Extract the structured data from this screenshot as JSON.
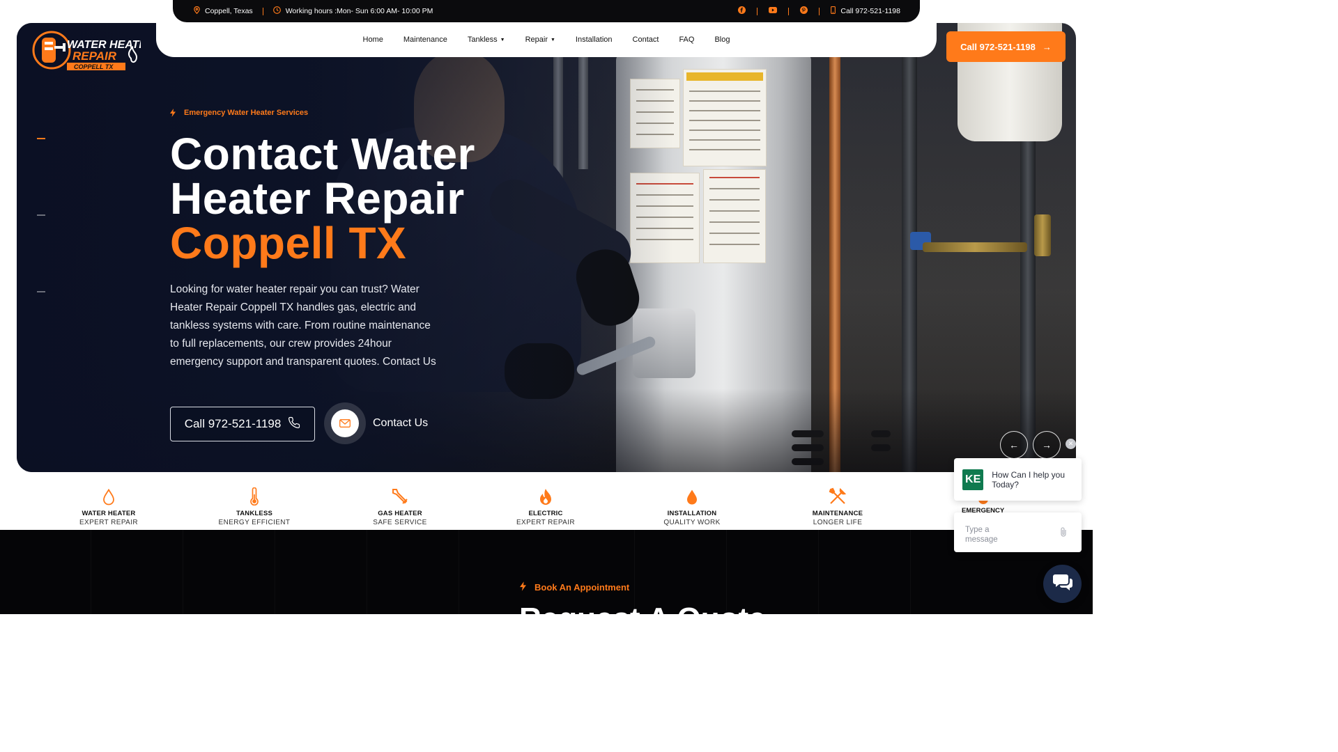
{
  "topbar": {
    "location": "Coppell, Texas",
    "hours": "Working hours :Mon- Sun 6:00 AM- 10:00 PM",
    "phone": "Call 972-521-1198",
    "social_icons": [
      "facebook-icon",
      "youtube-icon",
      "pinterest-icon"
    ]
  },
  "logo": {
    "line1": "WATER HEATER",
    "line2": "REPAIR",
    "line3": "COPPELL TX"
  },
  "nav": {
    "items": [
      {
        "label": "Home",
        "dropdown": false
      },
      {
        "label": "Maintenance",
        "dropdown": false
      },
      {
        "label": "Tankless",
        "dropdown": true
      },
      {
        "label": "Repair",
        "dropdown": true
      },
      {
        "label": "Installation",
        "dropdown": false
      },
      {
        "label": "Contact",
        "dropdown": false
      },
      {
        "label": "FAQ",
        "dropdown": false
      },
      {
        "label": "Blog",
        "dropdown": false
      }
    ],
    "cta_label": "Call 972-521-1198"
  },
  "hero": {
    "eyebrow": "Emergency Water Heater Services",
    "title_line1": "Contact Water",
    "title_line2": "Heater Repair",
    "title_accent": "Coppell TX",
    "description": "Looking for water heater repair you can trust? Water Heater Repair Coppell TX handles gas, electric and tankless systems with care. From routine maintenance to full replacements, our crew provides 24hour emergency support and transparent quotes. Contact Us",
    "call_button": "Call 972-521-1198",
    "contact_link": "Contact Us"
  },
  "services": [
    {
      "title": "WATER HEATER",
      "subtitle": "EXPERT REPAIR",
      "icon": "water-drop-icon"
    },
    {
      "title": "TANKLESS",
      "subtitle": "ENERGY EFFICIENT",
      "icon": "thermometer-icon"
    },
    {
      "title": "GAS HEATER",
      "subtitle": "SAFE SERVICE",
      "icon": "wrench-icon"
    },
    {
      "title": "ELECTRIC",
      "subtitle": "EXPERT REPAIR",
      "icon": "flame-icon"
    },
    {
      "title": "INSTALLATION",
      "subtitle": "QUALITY WORK",
      "icon": "filled-drop-icon"
    },
    {
      "title": "MAINTENANCE",
      "subtitle": "LONGER LIFE",
      "icon": "tools-icon"
    },
    {
      "title": "EMERGENCY",
      "subtitle": "",
      "icon": "emergency-icon"
    }
  ],
  "booking": {
    "eyebrow": "Book An Appointment",
    "heading": "Request A Quote"
  },
  "chat": {
    "avatar": "KE",
    "greeting": "How Can I help you Today?",
    "placeholder": "Type a message"
  },
  "colors": {
    "accent": "#ff7a1a",
    "dark": "#0b0b0d",
    "hero_overlay": "#0e1428",
    "chat_green": "#0f7a4f",
    "chat_fab": "#1c2a48"
  }
}
